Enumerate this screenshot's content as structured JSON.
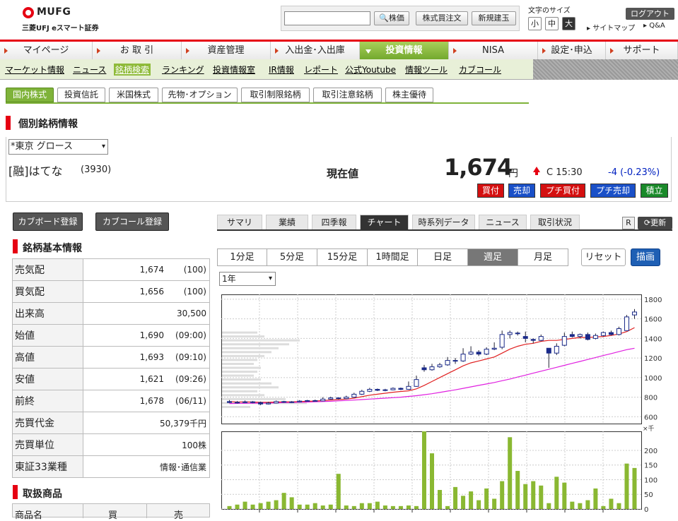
{
  "header": {
    "logo": "MUFG",
    "logo_sub": "三菱UFJ eスマート証券",
    "search_placeholder": "",
    "btn_stock": "株価",
    "btn_order": "株式買注文",
    "btn_new": "新規建玉",
    "font_label": "文字のサイズ",
    "font_small": "小",
    "font_mid": "中",
    "font_large": "大",
    "logout": "ログアウト",
    "sitemap": "サイトマップ",
    "qa": "Q&A"
  },
  "mainnav": [
    "マイページ",
    "お 取 引",
    "資産管理",
    "入出金･入出庫",
    "投資情報",
    "NISA",
    "設定･申込",
    "サポート"
  ],
  "subnav": [
    "マーケット情報",
    "ニュース",
    "銘柄検索",
    "ランキング",
    "投資情報室",
    "IR情報",
    "レポート",
    "公式Youtube",
    "情報ツール",
    "カブコール"
  ],
  "tabs": [
    "国内株式",
    "投資信託",
    "米国株式",
    "先物･オプション",
    "取引制限銘柄",
    "取引注意銘柄",
    "株主優待"
  ],
  "page_title": "個別銘柄情報",
  "stock": {
    "market": "*東京 グロース",
    "name": "[融]はてな",
    "code": "(3930)",
    "price_label": "現在値",
    "price": "1,674",
    "unit": "円",
    "time": "C 15:30",
    "change": "-4 (-0.23%)"
  },
  "order_buttons": [
    "買付",
    "売却",
    "プチ買付",
    "プチ売却",
    "積立"
  ],
  "left_buttons": [
    "カブボード登録",
    "カブコール登録"
  ],
  "basic_title": "銘柄基本情報",
  "basic_rows": [
    {
      "label": "売気配",
      "value": "1,674",
      "sub": "(100)"
    },
    {
      "label": "買気配",
      "value": "1,656",
      "sub": "(100)"
    },
    {
      "label": "出来高",
      "value": "30,500",
      "sub": ""
    },
    {
      "label": "始値",
      "value": "1,690",
      "sub": "(09:00)"
    },
    {
      "label": "高値",
      "value": "1,693",
      "sub": "(09:10)"
    },
    {
      "label": "安値",
      "value": "1,621",
      "sub": "(09:26)"
    },
    {
      "label": "前終",
      "value": "1,678",
      "sub": "(06/11)"
    },
    {
      "label": "売買代金",
      "value": "50,379千円",
      "sub": ""
    },
    {
      "label": "売買単位",
      "value": "100株",
      "sub": ""
    },
    {
      "label": "東証33業種",
      "value": "情報･通信業",
      "sub": ""
    }
  ],
  "products_title": "取扱商品",
  "products_head": [
    "商品名",
    "買",
    "売"
  ],
  "chart_tabs": [
    "サマリ",
    "業績",
    "四季報",
    "チャート",
    "時系列データ",
    "ニュース",
    "取引状況"
  ],
  "refresh": "更新",
  "r_label": "R",
  "period_buttons": [
    "1分足",
    "5分足",
    "15分足",
    "1時間足",
    "日足",
    "週足",
    "月足"
  ],
  "reset": "リセット",
  "draw": "描画",
  "period_select": "1年",
  "chart_data": {
    "type": "candlestick",
    "yticks": [
      600,
      800,
      1000,
      1200,
      1400,
      1600,
      1800
    ],
    "vol_ticks": [
      0,
      50,
      100,
      150,
      200
    ],
    "vol_unit": "×千",
    "ylim": [
      530,
      1850
    ],
    "vol_lim": [
      0,
      265
    ],
    "candles": [
      [
        755,
        745,
        770,
        740
      ],
      [
        742,
        748,
        760,
        735
      ],
      [
        748,
        752,
        765,
        740
      ],
      [
        752,
        745,
        760,
        738
      ],
      [
        745,
        730,
        755,
        718
      ],
      [
        730,
        740,
        752,
        725
      ],
      [
        740,
        755,
        765,
        735
      ],
      [
        755,
        748,
        762,
        742
      ],
      [
        748,
        752,
        760,
        740
      ],
      [
        752,
        760,
        770,
        748
      ],
      [
        760,
        765,
        772,
        755
      ],
      [
        765,
        762,
        775,
        758
      ],
      [
        762,
        780,
        800,
        758
      ],
      [
        780,
        792,
        805,
        775
      ],
      [
        792,
        785,
        798,
        778
      ],
      [
        785,
        800,
        815,
        780
      ],
      [
        800,
        830,
        845,
        795
      ],
      [
        830,
        860,
        875,
        822
      ],
      [
        860,
        880,
        895,
        852
      ],
      [
        880,
        870,
        888,
        862
      ],
      [
        870,
        875,
        885,
        860
      ],
      [
        875,
        890,
        900,
        870
      ],
      [
        890,
        880,
        898,
        872
      ],
      [
        880,
        910,
        960,
        875
      ],
      [
        910,
        980,
        1020,
        905
      ],
      [
        1100,
        1080,
        1130,
        1060
      ],
      [
        1080,
        1110,
        1140,
        1070
      ],
      [
        1110,
        1130,
        1150,
        1100
      ],
      [
        1130,
        1175,
        1210,
        1120
      ],
      [
        1175,
        1170,
        1200,
        1140
      ],
      [
        1170,
        1240,
        1300,
        1160
      ],
      [
        1240,
        1260,
        1320,
        1230
      ],
      [
        1260,
        1240,
        1280,
        1220
      ],
      [
        1240,
        1290,
        1310,
        1230
      ],
      [
        1290,
        1300,
        1360,
        1280
      ],
      [
        1310,
        1440,
        1480,
        1290
      ],
      [
        1440,
        1460,
        1480,
        1400
      ],
      [
        1455,
        1450,
        1470,
        1430
      ],
      [
        1420,
        1400,
        1470,
        1360
      ],
      [
        1390,
        1380,
        1400,
        1350
      ],
      [
        1380,
        1420,
        1440,
        1370
      ],
      [
        1300,
        1250,
        1280,
        1100
      ],
      [
        1250,
        1320,
        1350,
        1230
      ],
      [
        1330,
        1420,
        1460,
        1320
      ],
      [
        1440,
        1420,
        1470,
        1410
      ],
      [
        1420,
        1440,
        1450,
        1400
      ],
      [
        1440,
        1390,
        1460,
        1380
      ],
      [
        1400,
        1430,
        1450,
        1390
      ],
      [
        1430,
        1460,
        1470,
        1420
      ],
      [
        1460,
        1440,
        1480,
        1430
      ],
      [
        1440,
        1500,
        1520,
        1430
      ],
      [
        1480,
        1620,
        1640,
        1480
      ],
      [
        1640,
        1670,
        1700,
        1600
      ]
    ],
    "ma_short": [
      755,
      750,
      752,
      750,
      748,
      748,
      750,
      752,
      752,
      755,
      758,
      760,
      765,
      770,
      775,
      780,
      790,
      805,
      820,
      830,
      840,
      850,
      858,
      865,
      885,
      920,
      960,
      1000,
      1040,
      1080,
      1120,
      1150,
      1170,
      1190,
      1210,
      1250,
      1290,
      1320,
      1340,
      1350,
      1370,
      1380,
      1380,
      1390,
      1400,
      1410,
      1410,
      1415,
      1420,
      1430,
      1445,
      1470,
      1510
    ],
    "ma_long": [
      735,
      736,
      737,
      738,
      739,
      740,
      742,
      744,
      746,
      748,
      750,
      752,
      755,
      758,
      762,
      766,
      770,
      775,
      780,
      785,
      790,
      795,
      800,
      808,
      815,
      825,
      835,
      848,
      862,
      875,
      890,
      905,
      920,
      935,
      950,
      968,
      985,
      1005,
      1025,
      1045,
      1065,
      1085,
      1105,
      1125,
      1145,
      1165,
      1185,
      1205,
      1225,
      1245,
      1265,
      1285,
      1300
    ],
    "volume": [
      10,
      15,
      25,
      15,
      20,
      25,
      30,
      55,
      40,
      15,
      15,
      20,
      12,
      15,
      120,
      12,
      10,
      20,
      20,
      25,
      12,
      10,
      10,
      12,
      10,
      265,
      190,
      65,
      10,
      75,
      45,
      60,
      30,
      70,
      35,
      95,
      245,
      130,
      85,
      95,
      80,
      20,
      110,
      90,
      25,
      20,
      30,
      70,
      10,
      35,
      20,
      155,
      140
    ]
  }
}
